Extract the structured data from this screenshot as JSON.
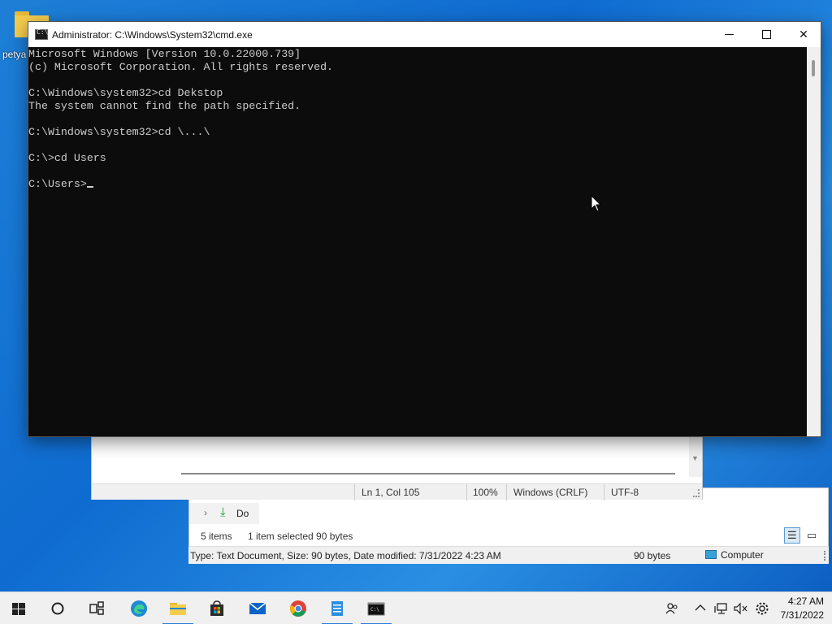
{
  "desktop": {
    "icon_label": "petya"
  },
  "cmd": {
    "title": "Administrator: C:\\Windows\\System32\\cmd.exe",
    "icon_text": "C:\\",
    "lines": [
      "Microsoft Windows [Version 10.0.22000.739]",
      "(c) Microsoft Corporation. All rights reserved.",
      "",
      "C:\\Windows\\system32>cd Dekstop",
      "The system cannot find the path specified.",
      "",
      "C:\\Windows\\system32>cd \\...\\",
      "",
      "C:\\>cd Users",
      "",
      "C:\\Users>"
    ]
  },
  "notepad": {
    "status": {
      "position": "Ln 1, Col 105",
      "zoom": "100%",
      "line_endings": "Windows (CRLF)",
      "encoding": "UTF-8"
    }
  },
  "explorer": {
    "nav_item": "Do",
    "item_count": "5 items",
    "selection": "1 item selected  90 bytes",
    "details": "Type: Text Document, Size: 90 bytes, Date modified: 7/31/2022 4:23 AM",
    "size": "90 bytes",
    "location": "Computer"
  },
  "taskbar": {
    "items": [
      "start",
      "search",
      "task-view",
      "edge",
      "file-explorer",
      "store",
      "mail",
      "chrome",
      "notepad",
      "cmd"
    ],
    "time": "4:27 AM",
    "date": "7/31/2022"
  },
  "colors": {
    "desktop": "#1573d3",
    "console_bg": "#0c0c0c",
    "console_fg": "#cccccc",
    "accent": "#2a7ad6"
  }
}
